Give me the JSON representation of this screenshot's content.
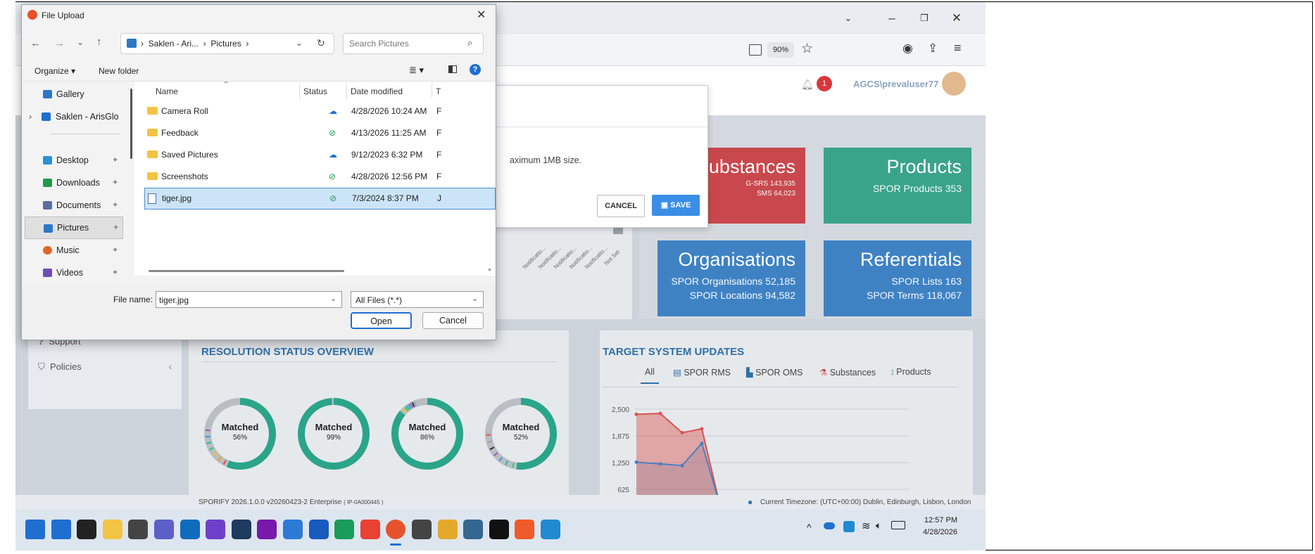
{
  "dialog": {
    "title": "File Upload",
    "breadcrumb": [
      "Saklen - Ari...",
      "Pictures"
    ],
    "search_placeholder": "Search Pictures",
    "organize_label": "Organize",
    "new_folder_label": "New folder",
    "sidebar": [
      {
        "label": "Gallery",
        "icon": "gallery-icon"
      },
      {
        "label": "Saklen - ArisGlo",
        "icon": "onedrive-icon"
      },
      {
        "label": "Desktop",
        "icon": "desktop-icon"
      },
      {
        "label": "Downloads",
        "icon": "download-icon"
      },
      {
        "label": "Documents",
        "icon": "documents-icon"
      },
      {
        "label": "Pictures",
        "icon": "pictures-icon"
      },
      {
        "label": "Music",
        "icon": "music-icon"
      },
      {
        "label": "Videos",
        "icon": "videos-icon"
      }
    ],
    "columns": {
      "name": "Name",
      "status": "Status",
      "date": "Date modified",
      "type": "T"
    },
    "files": [
      {
        "name": "Camera Roll",
        "status": "cloud",
        "date": "4/28/2026 10:24 AM",
        "type": "F",
        "kind": "folder"
      },
      {
        "name": "Feedback",
        "status": "synced",
        "date": "4/13/2026 11:25 AM",
        "type": "F",
        "kind": "folder"
      },
      {
        "name": "Saved Pictures",
        "status": "cloud",
        "date": "9/12/2023 6:32 PM",
        "type": "F",
        "kind": "folder"
      },
      {
        "name": "Screenshots",
        "status": "synced",
        "date": "4/28/2026 12:56 PM",
        "type": "F",
        "kind": "folder"
      },
      {
        "name": "tiger.jpg",
        "status": "synced",
        "date": "7/3/2024 8:37 PM",
        "type": "J",
        "kind": "file",
        "selected": true
      }
    ],
    "file_name_label": "File name:",
    "file_name_value": "tiger.jpg",
    "file_type": "All Files (*.*)",
    "open_label": "Open",
    "cancel_label": "Cancel"
  },
  "browser": {
    "zoom": "90%"
  },
  "app": {
    "notification_count": "1",
    "user": "AGCS\\prevaluser77",
    "modal": {
      "text": "aximum 1MB size.",
      "cancel_label": "CANCEL",
      "save_label": "SAVE"
    },
    "tiles": [
      {
        "title": "Substances",
        "lines": [
          "G-SRS 143,935",
          "SMS 64,023"
        ],
        "color": "#c9484d"
      },
      {
        "title": "Products",
        "lines": [
          "SPOR Products 353"
        ],
        "color": "#3aa48a"
      },
      {
        "title": "Organisations",
        "lines": [
          "SPOR Organisations 52,185",
          "SPOR Locations 94,582"
        ],
        "color": "#3f82c4"
      },
      {
        "title": "Referentials",
        "lines": [
          "SPOR Lists 163",
          "SPOR Terms 118,067"
        ],
        "color": "#3f82c4"
      }
    ],
    "menu": [
      {
        "label": "Support",
        "icon": "question-icon"
      },
      {
        "label": "Policies",
        "icon": "shield-icon"
      }
    ],
    "chart_axis_labels": [
      "Notificatio...",
      "Notificatio...",
      "Notificatio...",
      "Notificatio...",
      "Notificatio...",
      "Not Set"
    ],
    "resolution": {
      "title": "RESOLUTION STATUS OVERVIEW",
      "donuts": [
        {
          "label": "Matched",
          "pct": "56%",
          "value": 56
        },
        {
          "label": "Matched",
          "pct": "99%",
          "value": 99
        },
        {
          "label": "Matched",
          "pct": "86%",
          "value": 86
        },
        {
          "label": "Matched",
          "pct": "52%",
          "value": 52
        }
      ]
    },
    "updates": {
      "title": "TARGET SYSTEM UPDATES",
      "tabs": [
        "All",
        "SPOR RMS",
        "SPOR OMS",
        "Substances",
        "Products"
      ],
      "y_ticks": [
        "2,500",
        "1,875",
        "1,250",
        "625"
      ]
    },
    "footer_version": "SPORIFY 2026.1.0.0 v20260423-2 Enterprise",
    "footer_instance": "( IP-0A000445 )",
    "footer_timezone": "Current Timezone: (UTC+00:00) Dublin, Edinburgh, Lisbon, London"
  },
  "chart_data": {
    "type": "area",
    "series": [
      {
        "values": [
          2380,
          2400,
          1950,
          2040,
          300
        ],
        "color": "#d9534f"
      },
      {
        "values": [
          1260,
          1220,
          1180,
          1700,
          300
        ],
        "color": "#4a7fc1"
      }
    ],
    "ylim": [
      625,
      2500
    ]
  },
  "taskbar": {
    "time": "12:57 PM",
    "date": "4/28/2026"
  }
}
